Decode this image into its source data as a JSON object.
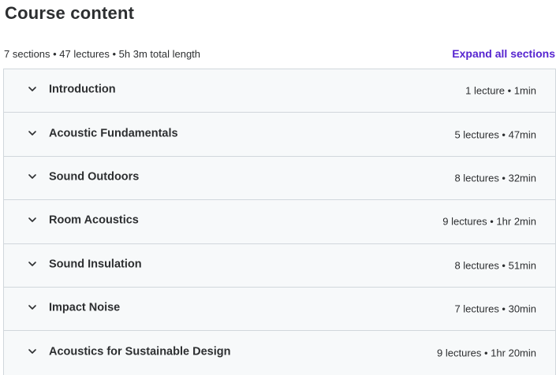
{
  "heading": "Course content",
  "summary": "7 sections • 47 lectures • 5h 3m total length",
  "expand_label": "Expand all sections",
  "colors": {
    "accent": "#5624d0",
    "section_bg": "#f7f9fa",
    "border": "#d1d7dc",
    "text": "#2d2f31"
  },
  "sections": [
    {
      "title": "Introduction",
      "meta": "1 lecture • 1min",
      "icon": "chevron-down-icon"
    },
    {
      "title": "Acoustic Fundamentals",
      "meta": "5 lectures • 47min",
      "icon": "chevron-down-icon"
    },
    {
      "title": "Sound Outdoors",
      "meta": "8 lectures • 32min",
      "icon": "chevron-down-icon"
    },
    {
      "title": "Room Acoustics",
      "meta": "9 lectures • 1hr 2min",
      "icon": "chevron-down-icon"
    },
    {
      "title": "Sound Insulation",
      "meta": "8 lectures • 51min",
      "icon": "chevron-down-icon"
    },
    {
      "title": "Impact Noise",
      "meta": "7 lectures • 30min",
      "icon": "chevron-down-icon"
    },
    {
      "title": "Acoustics for Sustainable Design",
      "meta": "9 lectures • 1hr 20min",
      "icon": "chevron-down-icon"
    }
  ]
}
